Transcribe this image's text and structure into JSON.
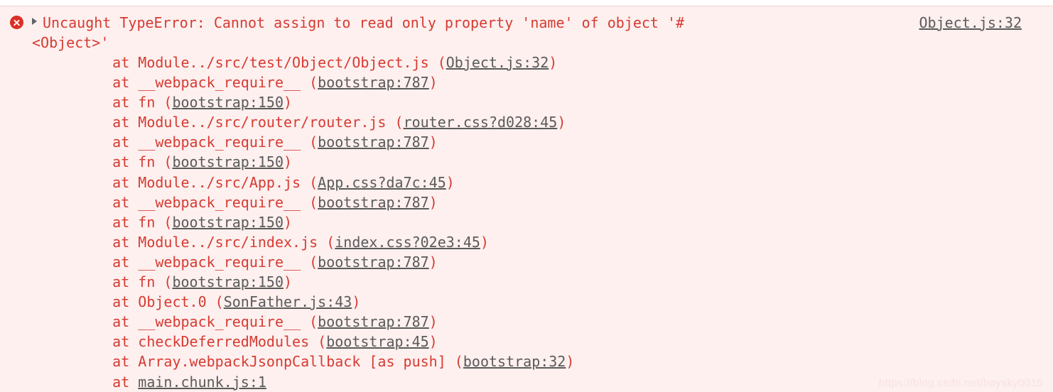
{
  "console": {
    "icon": "error-circle-icon",
    "disclosure": "disclosure-triangle-icon",
    "message_head": "Uncaught TypeError: Cannot assign to read only property 'name' of object '#",
    "message_wrap": "<Object>'",
    "source_link": "Object.js:32",
    "colors": {
      "background": "#fdf0ef",
      "border": "#f4cfcc",
      "error_text": "#d63b32",
      "link_text": "#5a5a5a",
      "icon": "#d93025"
    },
    "stack": [
      {
        "fn": "    at Module../src/test/Object/Object.js (",
        "loc": "Object.js:32",
        "tail": ")"
      },
      {
        "fn": "    at __webpack_require__ (",
        "loc": "bootstrap:787",
        "tail": ")"
      },
      {
        "fn": "    at fn (",
        "loc": "bootstrap:150",
        "tail": ")"
      },
      {
        "fn": "    at Module../src/router/router.js (",
        "loc": "router.css?d028:45",
        "tail": ")"
      },
      {
        "fn": "    at __webpack_require__ (",
        "loc": "bootstrap:787",
        "tail": ")"
      },
      {
        "fn": "    at fn (",
        "loc": "bootstrap:150",
        "tail": ")"
      },
      {
        "fn": "    at Module../src/App.js (",
        "loc": "App.css?da7c:45",
        "tail": ")"
      },
      {
        "fn": "    at __webpack_require__ (",
        "loc": "bootstrap:787",
        "tail": ")"
      },
      {
        "fn": "    at fn (",
        "loc": "bootstrap:150",
        "tail": ")"
      },
      {
        "fn": "    at Module../src/index.js (",
        "loc": "index.css?02e3:45",
        "tail": ")"
      },
      {
        "fn": "    at __webpack_require__ (",
        "loc": "bootstrap:787",
        "tail": ")"
      },
      {
        "fn": "    at fn (",
        "loc": "bootstrap:150",
        "tail": ")"
      },
      {
        "fn": "    at Object.0 (",
        "loc": "SonFather.js:43",
        "tail": ")"
      },
      {
        "fn": "    at __webpack_require__ (",
        "loc": "bootstrap:787",
        "tail": ")"
      },
      {
        "fn": "    at checkDeferredModules (",
        "loc": "bootstrap:45",
        "tail": ")"
      },
      {
        "fn": "    at Array.webpackJsonpCallback [as push] (",
        "loc": "bootstrap:32",
        "tail": ")"
      },
      {
        "fn": "    at ",
        "loc": "main.chunk.js:1",
        "tail": ""
      }
    ]
  },
  "watermark": {
    "text": "https://blog.csdn.net/boysky0015"
  }
}
